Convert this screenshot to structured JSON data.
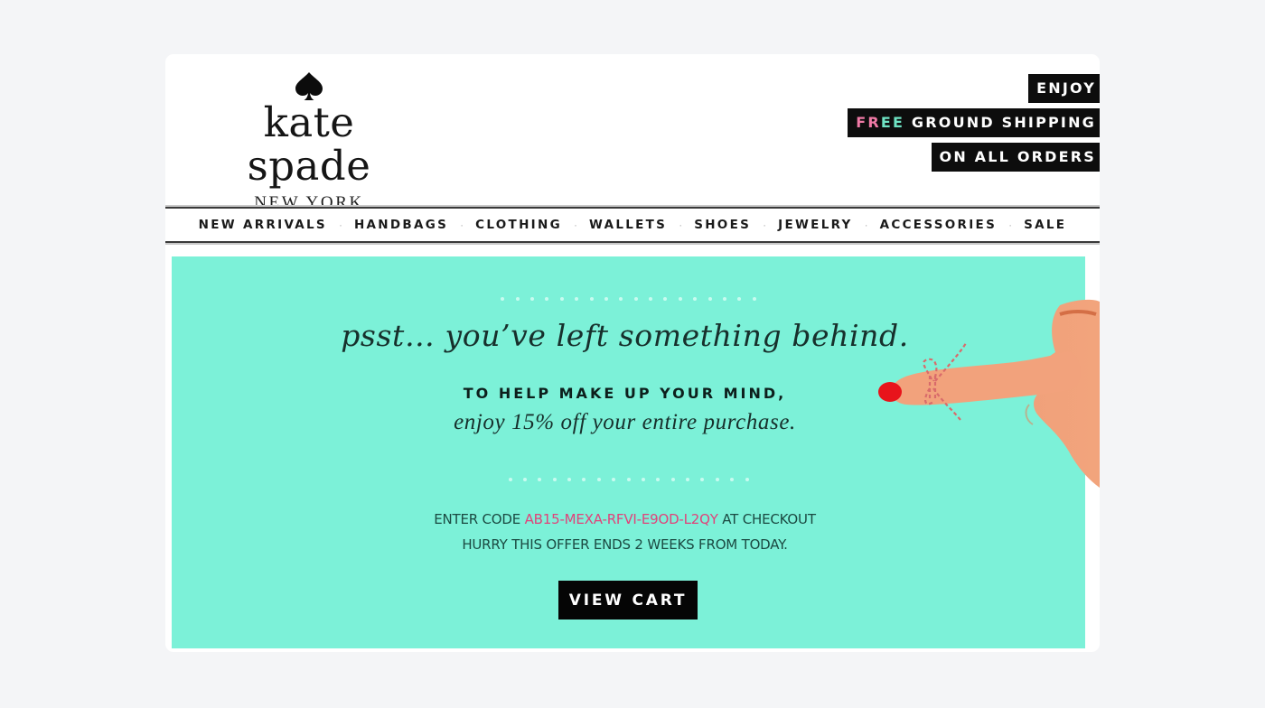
{
  "brand": {
    "logo_icon": "spade-icon",
    "name": "kate spade",
    "location": "NEW YORK"
  },
  "promo": {
    "line1": "ENJOY",
    "line2_highlight": [
      "F",
      "R",
      "E",
      "E"
    ],
    "line2_rest": " GROUND SHIPPING",
    "line3": "ON ALL ORDERS"
  },
  "nav": {
    "items": [
      "NEW ARRIVALS",
      "HANDBAGS",
      "CLOTHING",
      "WALLETS",
      "SHOES",
      "JEWELRY",
      "ACCESSORIES",
      "SALE"
    ],
    "separator": "·"
  },
  "hero": {
    "headline": "psst… you’ve left something behind.",
    "sub_caps": "TO HELP MAKE UP YOUR MIND,",
    "sub_italic": "enjoy 15% off your entire purchase.",
    "code_prefix": "ENTER CODE ",
    "code": "AB15-MEXA-RFVI-E9OD-L2QY",
    "code_suffix": " AT CHECKOUT",
    "hurry": "HURRY THIS OFFER ENDS 2 WEEKS FROM TODAY.",
    "cta_label": "VIEW CART",
    "image": "pointing-finger-with-string-bow",
    "colors": {
      "background": "#7cf1d8",
      "code": "#e0437a",
      "cta_bg": "#050505",
      "nail": "#e8141b"
    }
  }
}
